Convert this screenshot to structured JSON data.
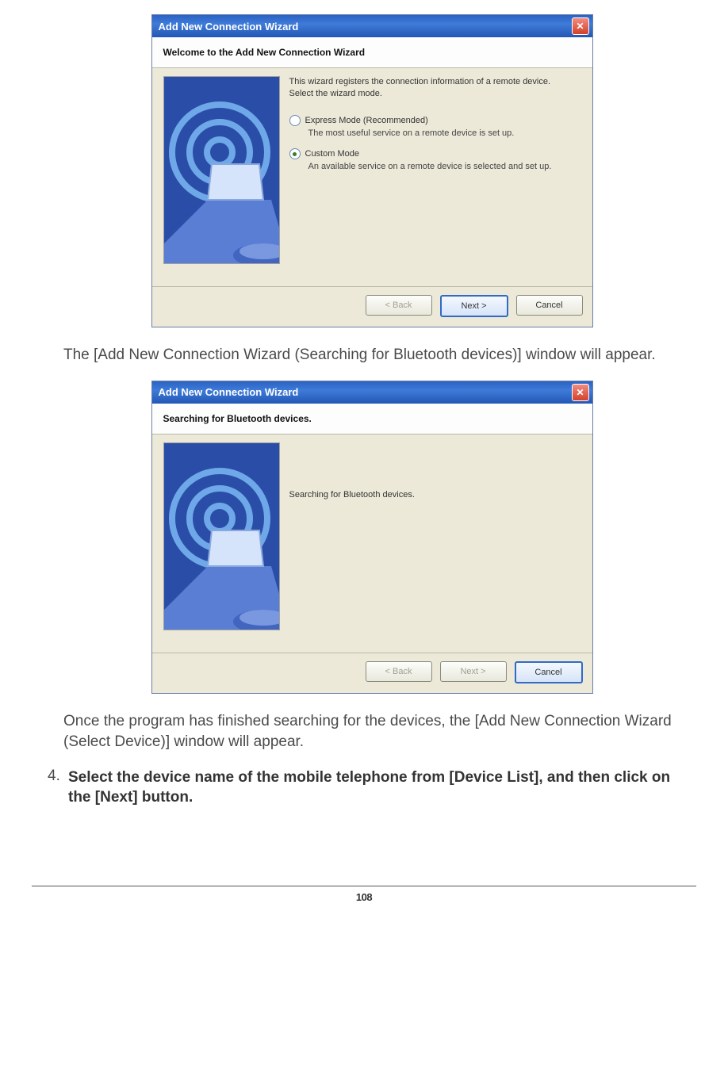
{
  "wizard1": {
    "title": "Add New Connection Wizard",
    "banner": "Welcome to the Add New Connection Wizard",
    "intro1": "This wizard registers the connection information of a remote device.",
    "intro2": "Select the wizard mode.",
    "option_express": "Express Mode (Recommended)",
    "option_express_desc": "The most useful service on a remote device is set up.",
    "option_custom": "Custom Mode",
    "option_custom_desc": "An available service on a remote device is selected and set up.",
    "back": "< Back",
    "next": "Next >",
    "cancel": "Cancel"
  },
  "para1": "The [Add New Connection Wizard (Searching for Bluetooth devices)] window will appear.",
  "wizard2": {
    "title": "Add New Connection Wizard",
    "banner": "Searching for Bluetooth devices.",
    "message": "Searching for Bluetooth devices.",
    "back": "< Back",
    "next": "Next >",
    "cancel": "Cancel"
  },
  "para2": "Once the program has finished searching for the devices, the [Add New Connection Wizard (Select Device)] window will appear.",
  "step4_num": "4.",
  "step4_text": "Select the device name of the mobile telephone from [Device List], and then click on the [Next] button.",
  "page_number": "108"
}
